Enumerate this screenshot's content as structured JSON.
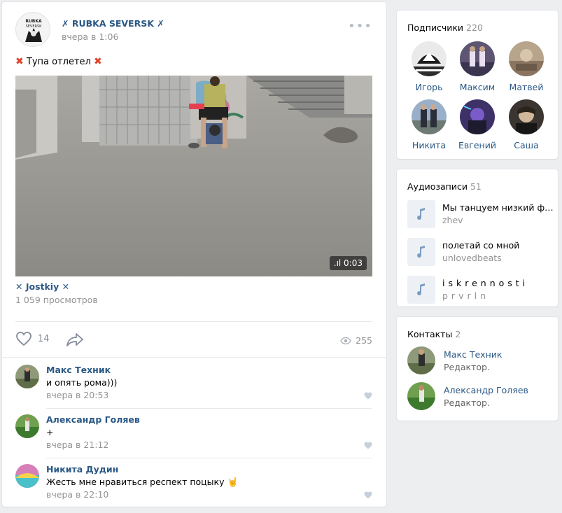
{
  "post": {
    "group_name": "✗ RUBKA SEVERSK ✗",
    "date": "вчера в 1:06",
    "text": "Тупа отлетел",
    "text_icon": "cross-mark-emoji",
    "video": {
      "duration": "0:03",
      "title": "✕ Jostkiy ✕",
      "views": "1 059 просмотров"
    },
    "likes": "14",
    "views": "255",
    "icons": {
      "like": "heart-icon",
      "share": "share-arrow-icon",
      "views": "eye-icon",
      "menu": "more-dots-icon"
    }
  },
  "comments": [
    {
      "author": "Макс Техник",
      "text": "и опять рома)))",
      "date": "вчера в 20:53"
    },
    {
      "author": "Александр Голяев",
      "text": "+",
      "date": "вчера в 21:12"
    },
    {
      "author": "Никита Дудин",
      "text": "Жесть мне нравиться респект поцыку 🤘",
      "date": "вчера в 22:10"
    }
  ],
  "subscribers": {
    "title": "Подписчики",
    "count": "220",
    "people": [
      {
        "name": "Игорь"
      },
      {
        "name": "Максим"
      },
      {
        "name": "Матвей"
      },
      {
        "name": "Никита"
      },
      {
        "name": "Евгений"
      },
      {
        "name": "Саша"
      }
    ]
  },
  "audio": {
    "title": "Аудиозаписи",
    "count": "51",
    "tracks": [
      {
        "title": "Мы танцуем низкий фле...",
        "artist": "zhev"
      },
      {
        "title": "полетай со мной",
        "artist": "unlovedbeats"
      },
      {
        "title": "iskrennosti",
        "artist": "prvrln"
      }
    ]
  },
  "contacts": {
    "title": "Контакты",
    "count": "2",
    "people": [
      {
        "name": "Макс Техник",
        "role": "Редактор."
      },
      {
        "name": "Александр Голяев",
        "role": "Редактор."
      }
    ]
  },
  "colors": {
    "link": "#2a5885",
    "muted": "#939393",
    "background": "#edeef0",
    "accent_red": "#e0432a"
  }
}
